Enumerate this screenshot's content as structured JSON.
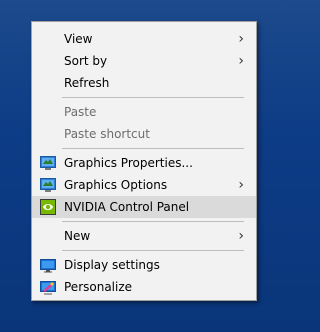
{
  "menu": {
    "items": [
      {
        "label": "View"
      },
      {
        "label": "Sort by"
      },
      {
        "label": "Refresh"
      },
      {
        "label": "Paste"
      },
      {
        "label": "Paste shortcut"
      },
      {
        "label": "Graphics Properties..."
      },
      {
        "label": "Graphics Options"
      },
      {
        "label": "NVIDIA Control Panel"
      },
      {
        "label": "New"
      },
      {
        "label": "Display settings"
      },
      {
        "label": "Personalize"
      }
    ],
    "submenu_arrow": "›",
    "icons": {
      "graphics_properties": "intel-graphics-icon",
      "graphics_options": "intel-graphics-icon",
      "nvidia": "nvidia-icon",
      "display_settings": "monitor-icon",
      "personalize": "personalize-icon"
    }
  },
  "colors": {
    "desktop": "#0d3c86",
    "menu_background": "#f2f2f2",
    "highlight": "#dadada",
    "disabled_text": "#6d6d6d",
    "nvidia_green": "#76b900"
  }
}
